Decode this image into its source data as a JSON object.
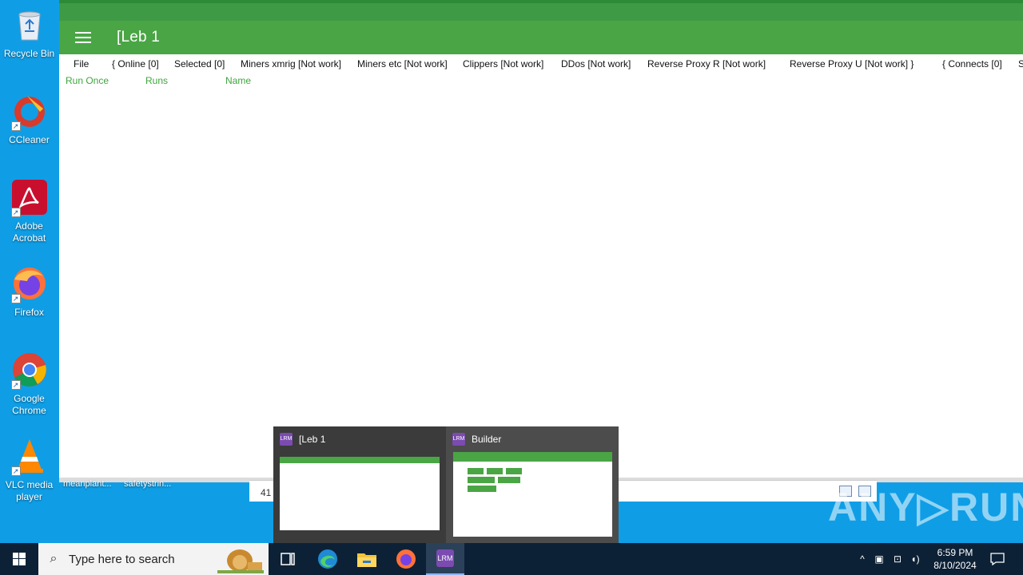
{
  "desktop": {
    "icons": [
      {
        "label": "Recycle Bin"
      },
      {
        "label": "CCleaner"
      },
      {
        "label": "Adobe Acrobat"
      },
      {
        "label": "Firefox"
      },
      {
        "label": "Google Chrome"
      },
      {
        "label": "VLC media player"
      }
    ],
    "files": [
      "meanplant...",
      "safetystrin..."
    ]
  },
  "app": {
    "title": "[Leb 1",
    "menu": [
      "File",
      "{ Online [0]",
      "Selected [0]",
      "Miners xmrig [Not work]",
      "Miners etc [Not work]",
      "Clippers [Not work]",
      "DDos [Not work]",
      "Reverse Proxy R [Not work]",
      "Reverse Proxy U [Not work] }",
      "{ Connects [0]",
      "S"
    ],
    "columns": [
      "Run Once",
      "Runs",
      "Name"
    ]
  },
  "status": {
    "count_text": "41 i"
  },
  "thumbnails": [
    {
      "title": "[Leb 1"
    },
    {
      "title": "Builder"
    }
  ],
  "watermark": "ANY▷RUN",
  "taskbar": {
    "search_placeholder": "Type here to search",
    "time": "6:59 PM",
    "date": "8/10/2024"
  },
  "colors": {
    "desktop_bg": "#0f9ee6",
    "app_header": "#4aa545",
    "column_text": "#3fa53f",
    "taskbar_bg": "#0d2136"
  }
}
